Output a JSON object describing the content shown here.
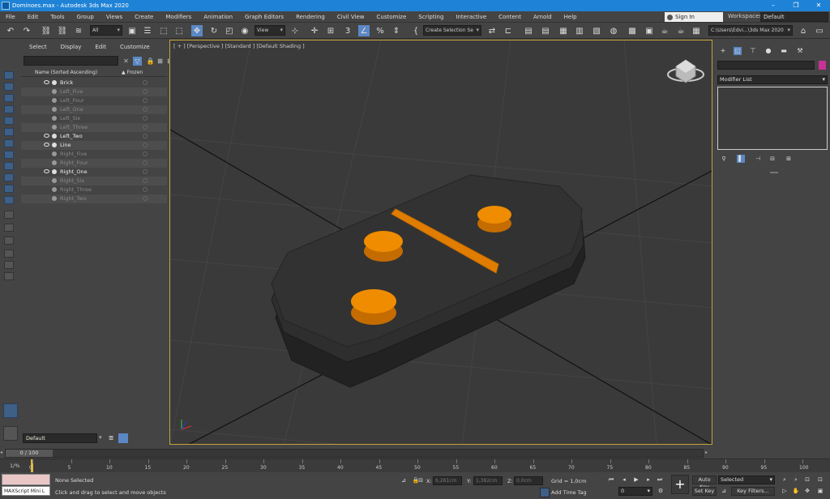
{
  "window": {
    "title": "Dominoes.max - Autodesk 3ds Max 2020",
    "minimize": "–",
    "maximize": "❐",
    "close": "✕"
  },
  "menubar": {
    "items": [
      "File",
      "Edit",
      "Tools",
      "Group",
      "Views",
      "Create",
      "Modifiers",
      "Animation",
      "Graph Editors",
      "Rendering",
      "Civil View",
      "Customize",
      "Scripting",
      "Interactive",
      "Content",
      "Arnold",
      "Help"
    ],
    "signin": "Sign In",
    "workspaces_label": "Workspaces:",
    "workspaces_value": "Default"
  },
  "toolbar": {
    "undo": "↶",
    "redo": "↷",
    "selection_filter": "All",
    "ref_coord": "View",
    "named_selection": "Create Selection Se",
    "project_path": "C:\\Users\\Edvi...\\3ds Max 2020"
  },
  "explorer": {
    "menu": [
      "Select",
      "Display",
      "Edit",
      "Customize"
    ],
    "col_name": "Name (Sorted Ascending)",
    "col_frozen": "▲ Frozen",
    "rows": [
      {
        "name": "Brick",
        "visible": true
      },
      {
        "name": "Left_Five",
        "visible": false
      },
      {
        "name": "Left_Four",
        "visible": false
      },
      {
        "name": "Left_One",
        "visible": false
      },
      {
        "name": "Left_Six",
        "visible": false
      },
      {
        "name": "Left_Three",
        "visible": false
      },
      {
        "name": "Left_Two",
        "visible": true
      },
      {
        "name": "Line",
        "visible": true
      },
      {
        "name": "Right_Five",
        "visible": false
      },
      {
        "name": "Right_Four",
        "visible": false
      },
      {
        "name": "Right_One",
        "visible": true
      },
      {
        "name": "Right_Six",
        "visible": false
      },
      {
        "name": "Right_Three",
        "visible": false
      },
      {
        "name": "Right_Two",
        "visible": false
      }
    ],
    "layer": "Default"
  },
  "viewport": {
    "label": "[ + ] [Perspective ] [Standard ] [Default Shading ]",
    "domino_color": "#2e2e2e",
    "pip_color": "#f08c00"
  },
  "command_panel": {
    "modifier_list": "Modifier List",
    "object_color": "#c83296"
  },
  "timeline": {
    "frame_readout": "0 / 100",
    "ticks": [
      0,
      5,
      10,
      15,
      20,
      25,
      30,
      35,
      40,
      45,
      50,
      55,
      60,
      65,
      70,
      75,
      80,
      85,
      90,
      95,
      100
    ],
    "current_frame": "1/%"
  },
  "status": {
    "maxscript": "MAXScript Mini L",
    "selection": "None Selected",
    "prompt": "Click and drag to select and move objects",
    "x_label": "X:",
    "x_value": "6,281cm",
    "y_label": "Y:",
    "y_value": "1,382cm",
    "z_label": "Z:",
    "z_value": "0,0cm",
    "grid": "Grid = 1,0cm",
    "add_time_tag": "Add Time Tag",
    "auto_key": "Auto Key",
    "set_key": "Set Key",
    "key_mode": "Selected",
    "key_filters": "Key Filters...",
    "frame_field": "0"
  }
}
